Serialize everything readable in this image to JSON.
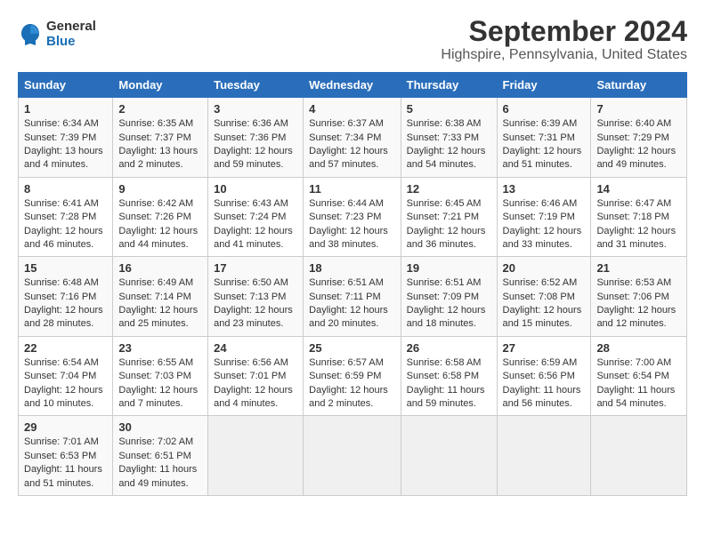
{
  "logo": {
    "general": "General",
    "blue": "Blue"
  },
  "title": "September 2024",
  "subtitle": "Highspire, Pennsylvania, United States",
  "headers": [
    "Sunday",
    "Monday",
    "Tuesday",
    "Wednesday",
    "Thursday",
    "Friday",
    "Saturday"
  ],
  "weeks": [
    [
      {
        "day": "1",
        "lines": [
          "Sunrise: 6:34 AM",
          "Sunset: 7:39 PM",
          "Daylight: 13 hours",
          "and 4 minutes."
        ]
      },
      {
        "day": "2",
        "lines": [
          "Sunrise: 6:35 AM",
          "Sunset: 7:37 PM",
          "Daylight: 13 hours",
          "and 2 minutes."
        ]
      },
      {
        "day": "3",
        "lines": [
          "Sunrise: 6:36 AM",
          "Sunset: 7:36 PM",
          "Daylight: 12 hours",
          "and 59 minutes."
        ]
      },
      {
        "day": "4",
        "lines": [
          "Sunrise: 6:37 AM",
          "Sunset: 7:34 PM",
          "Daylight: 12 hours",
          "and 57 minutes."
        ]
      },
      {
        "day": "5",
        "lines": [
          "Sunrise: 6:38 AM",
          "Sunset: 7:33 PM",
          "Daylight: 12 hours",
          "and 54 minutes."
        ]
      },
      {
        "day": "6",
        "lines": [
          "Sunrise: 6:39 AM",
          "Sunset: 7:31 PM",
          "Daylight: 12 hours",
          "and 51 minutes."
        ]
      },
      {
        "day": "7",
        "lines": [
          "Sunrise: 6:40 AM",
          "Sunset: 7:29 PM",
          "Daylight: 12 hours",
          "and 49 minutes."
        ]
      }
    ],
    [
      {
        "day": "8",
        "lines": [
          "Sunrise: 6:41 AM",
          "Sunset: 7:28 PM",
          "Daylight: 12 hours",
          "and 46 minutes."
        ]
      },
      {
        "day": "9",
        "lines": [
          "Sunrise: 6:42 AM",
          "Sunset: 7:26 PM",
          "Daylight: 12 hours",
          "and 44 minutes."
        ]
      },
      {
        "day": "10",
        "lines": [
          "Sunrise: 6:43 AM",
          "Sunset: 7:24 PM",
          "Daylight: 12 hours",
          "and 41 minutes."
        ]
      },
      {
        "day": "11",
        "lines": [
          "Sunrise: 6:44 AM",
          "Sunset: 7:23 PM",
          "Daylight: 12 hours",
          "and 38 minutes."
        ]
      },
      {
        "day": "12",
        "lines": [
          "Sunrise: 6:45 AM",
          "Sunset: 7:21 PM",
          "Daylight: 12 hours",
          "and 36 minutes."
        ]
      },
      {
        "day": "13",
        "lines": [
          "Sunrise: 6:46 AM",
          "Sunset: 7:19 PM",
          "Daylight: 12 hours",
          "and 33 minutes."
        ]
      },
      {
        "day": "14",
        "lines": [
          "Sunrise: 6:47 AM",
          "Sunset: 7:18 PM",
          "Daylight: 12 hours",
          "and 31 minutes."
        ]
      }
    ],
    [
      {
        "day": "15",
        "lines": [
          "Sunrise: 6:48 AM",
          "Sunset: 7:16 PM",
          "Daylight: 12 hours",
          "and 28 minutes."
        ]
      },
      {
        "day": "16",
        "lines": [
          "Sunrise: 6:49 AM",
          "Sunset: 7:14 PM",
          "Daylight: 12 hours",
          "and 25 minutes."
        ]
      },
      {
        "day": "17",
        "lines": [
          "Sunrise: 6:50 AM",
          "Sunset: 7:13 PM",
          "Daylight: 12 hours",
          "and 23 minutes."
        ]
      },
      {
        "day": "18",
        "lines": [
          "Sunrise: 6:51 AM",
          "Sunset: 7:11 PM",
          "Daylight: 12 hours",
          "and 20 minutes."
        ]
      },
      {
        "day": "19",
        "lines": [
          "Sunrise: 6:51 AM",
          "Sunset: 7:09 PM",
          "Daylight: 12 hours",
          "and 18 minutes."
        ]
      },
      {
        "day": "20",
        "lines": [
          "Sunrise: 6:52 AM",
          "Sunset: 7:08 PM",
          "Daylight: 12 hours",
          "and 15 minutes."
        ]
      },
      {
        "day": "21",
        "lines": [
          "Sunrise: 6:53 AM",
          "Sunset: 7:06 PM",
          "Daylight: 12 hours",
          "and 12 minutes."
        ]
      }
    ],
    [
      {
        "day": "22",
        "lines": [
          "Sunrise: 6:54 AM",
          "Sunset: 7:04 PM",
          "Daylight: 12 hours",
          "and 10 minutes."
        ]
      },
      {
        "day": "23",
        "lines": [
          "Sunrise: 6:55 AM",
          "Sunset: 7:03 PM",
          "Daylight: 12 hours",
          "and 7 minutes."
        ]
      },
      {
        "day": "24",
        "lines": [
          "Sunrise: 6:56 AM",
          "Sunset: 7:01 PM",
          "Daylight: 12 hours",
          "and 4 minutes."
        ]
      },
      {
        "day": "25",
        "lines": [
          "Sunrise: 6:57 AM",
          "Sunset: 6:59 PM",
          "Daylight: 12 hours",
          "and 2 minutes."
        ]
      },
      {
        "day": "26",
        "lines": [
          "Sunrise: 6:58 AM",
          "Sunset: 6:58 PM",
          "Daylight: 11 hours",
          "and 59 minutes."
        ]
      },
      {
        "day": "27",
        "lines": [
          "Sunrise: 6:59 AM",
          "Sunset: 6:56 PM",
          "Daylight: 11 hours",
          "and 56 minutes."
        ]
      },
      {
        "day": "28",
        "lines": [
          "Sunrise: 7:00 AM",
          "Sunset: 6:54 PM",
          "Daylight: 11 hours",
          "and 54 minutes."
        ]
      }
    ],
    [
      {
        "day": "29",
        "lines": [
          "Sunrise: 7:01 AM",
          "Sunset: 6:53 PM",
          "Daylight: 11 hours",
          "and 51 minutes."
        ]
      },
      {
        "day": "30",
        "lines": [
          "Sunrise: 7:02 AM",
          "Sunset: 6:51 PM",
          "Daylight: 11 hours",
          "and 49 minutes."
        ]
      },
      {
        "day": "",
        "lines": []
      },
      {
        "day": "",
        "lines": []
      },
      {
        "day": "",
        "lines": []
      },
      {
        "day": "",
        "lines": []
      },
      {
        "day": "",
        "lines": []
      }
    ]
  ]
}
